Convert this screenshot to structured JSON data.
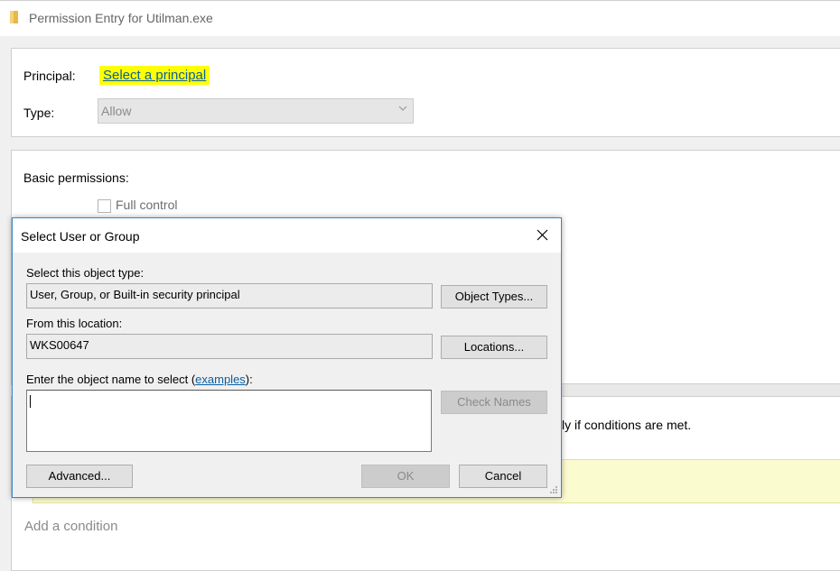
{
  "window": {
    "title": "Permission Entry for Utilman.exe",
    "icon": "folder-icon"
  },
  "principal": {
    "label": "Principal:",
    "link": "Select a principal"
  },
  "type": {
    "label": "Type:",
    "value": "Allow"
  },
  "permissions": {
    "heading": "Basic permissions:",
    "full_control": "Full control"
  },
  "condition": {
    "text_fragment": "ly if conditions are met.",
    "add_condition": "Add a condition"
  },
  "dialog": {
    "title": "Select User or Group",
    "object_type_label": "Select this object type:",
    "object_type_value": "User, Group, or Built-in security principal",
    "object_types_button": "Object Types...",
    "location_label": "From this location:",
    "location_value": "WKS00647",
    "locations_button": "Locations...",
    "object_name_label_prefix": "Enter the object name to select (",
    "examples_link": "examples",
    "object_name_label_suffix": "):",
    "object_name_value": "",
    "check_names_button": "Check Names",
    "advanced_button": "Advanced...",
    "ok_button": "OK",
    "cancel_button": "Cancel"
  },
  "colors": {
    "highlight": "#ffff00",
    "link": "#0b5fa0",
    "dialog_border": "#3a86c6",
    "warning_bar": "#fbfbd0"
  }
}
